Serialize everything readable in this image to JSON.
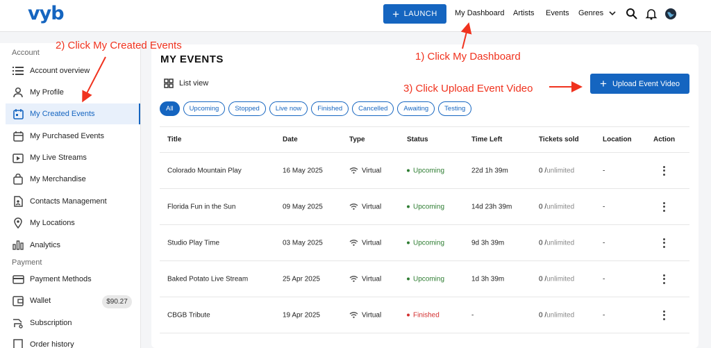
{
  "brand": {
    "logo": "vyb",
    "accent": "#1565c0"
  },
  "nav": {
    "launch_label": "LAUNCH",
    "my_dashboard": "My Dashboard",
    "artists": "Artists",
    "events": "Events",
    "genres": "Genres",
    "icons": [
      "search-icon",
      "bell-icon",
      "globe-avatar"
    ]
  },
  "sidebar": {
    "section_account": "Account",
    "section_payment": "Payment",
    "items": [
      {
        "label": "Account overview",
        "icon": "list-icon"
      },
      {
        "label": "My Profile",
        "icon": "person-icon"
      },
      {
        "label": "My Created Events",
        "icon": "calendar-icon",
        "active": true
      },
      {
        "label": "My Purchased Events",
        "icon": "calendar-check-icon"
      },
      {
        "label": "My Live Streams",
        "icon": "video-icon"
      },
      {
        "label": "My Merchandise",
        "icon": "bag-icon"
      },
      {
        "label": "Contacts Management",
        "icon": "contact-icon"
      },
      {
        "label": "My Locations",
        "icon": "pin-icon"
      },
      {
        "label": "Analytics",
        "icon": "bar-chart-icon"
      }
    ],
    "payment_items": [
      {
        "label": "Payment Methods",
        "icon": "card-icon"
      },
      {
        "label": "Wallet",
        "icon": "wallet-icon",
        "badge": "$90.27"
      },
      {
        "label": "Subscription",
        "icon": "subscription-icon"
      },
      {
        "label": "Order history",
        "icon": "history-icon"
      }
    ]
  },
  "main": {
    "title": "MY EVENTS",
    "list_view": "List view",
    "upload_label": "Upload Event Video",
    "filters": [
      "All",
      "Upcoming",
      "Stopped",
      "Live now",
      "Finished",
      "Cancelled",
      "Awaiting",
      "Testing"
    ],
    "columns": [
      "Title",
      "Date",
      "Type",
      "Status",
      "Time Left",
      "Tickets sold",
      "Location",
      "Action"
    ],
    "rows": [
      {
        "title": "Colorado Mountain Play",
        "date": "16 May 2025",
        "type": "Virtual",
        "status": "Upcoming",
        "time_left": "22d 1h 39m",
        "sold": "0 /",
        "limit": "unlimited",
        "location": "-"
      },
      {
        "title": "Florida Fun in the Sun",
        "date": "09 May 2025",
        "type": "Virtual",
        "status": "Upcoming",
        "time_left": "14d 23h 39m",
        "sold": "0 /",
        "limit": "unlimited",
        "location": "-"
      },
      {
        "title": "Studio Play Time",
        "date": "03 May 2025",
        "type": "Virtual",
        "status": "Upcoming",
        "time_left": "9d 3h 39m",
        "sold": "0 /",
        "limit": "unlimited",
        "location": "-"
      },
      {
        "title": "Baked Potato Live Stream",
        "date": "25 Apr 2025",
        "type": "Virtual",
        "status": "Upcoming",
        "time_left": "1d 3h 39m",
        "sold": "0 /",
        "limit": "unlimited",
        "location": "-"
      },
      {
        "title": "CBGB Tribute",
        "date": "19 Apr 2025",
        "type": "Virtual",
        "status": "Finished",
        "time_left": "-",
        "sold": "0 /",
        "limit": "unlimited",
        "location": "-"
      }
    ],
    "status_colors": {
      "Upcoming": "#2e7d32",
      "Finished": "#d32f2f"
    }
  },
  "annotations": {
    "step1": "1) Click My Dashboard",
    "step2": "2) Click My Created Events",
    "step3": "3) Click Upload Event Video",
    "color": "#f0321e"
  }
}
